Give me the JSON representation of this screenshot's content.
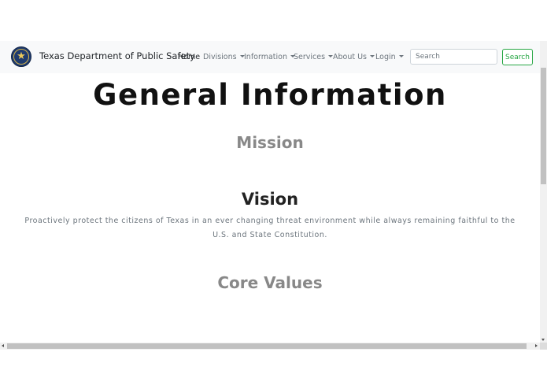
{
  "navbar": {
    "brand_name": "Texas Department of Public Safety",
    "logo_icon": "texas-star-seal-icon",
    "items": [
      {
        "label": "Home",
        "active": true,
        "dropdown": false
      },
      {
        "label": "Divisions",
        "active": false,
        "dropdown": true
      },
      {
        "label": "Information",
        "active": false,
        "dropdown": true
      },
      {
        "label": "Services",
        "active": false,
        "dropdown": true
      },
      {
        "label": "About Us",
        "active": false,
        "dropdown": true
      },
      {
        "label": "Login",
        "active": false,
        "dropdown": true
      }
    ],
    "search": {
      "placeholder": "Search",
      "value": "",
      "button_label": "Search"
    }
  },
  "main": {
    "title": "General Information",
    "sections": [
      {
        "heading": "Mission",
        "text": ""
      },
      {
        "heading": "Vision",
        "text": "Proactively protect the citizens of Texas in an ever changing threat environment while always remaining faithful to the U.S. and State Constitution."
      },
      {
        "heading": "Core Values",
        "text": ""
      }
    ]
  },
  "colors": {
    "navbar_bg": "#f8f9fa",
    "search_button": "#28a745",
    "heading_muted": "#888888",
    "body_text": "#6c757d"
  }
}
